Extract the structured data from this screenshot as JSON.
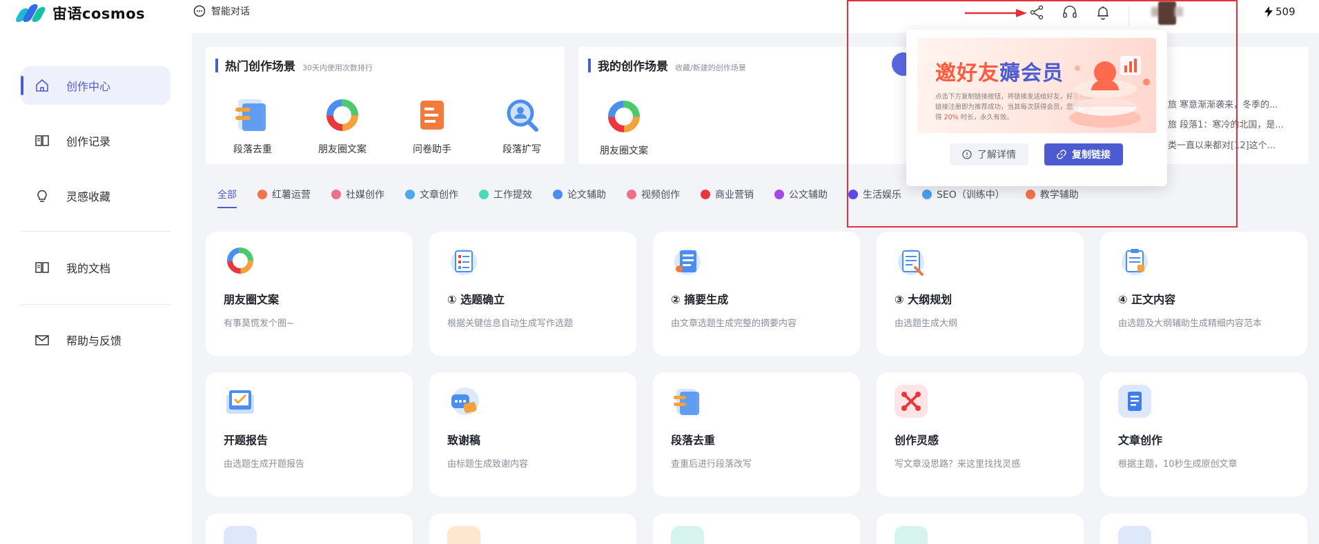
{
  "app": {
    "name": "宙语cosmos"
  },
  "topbar": {
    "smart_chat": "智能对话",
    "points": "509"
  },
  "sidebar": {
    "items": [
      {
        "label": "创作中心"
      },
      {
        "label": "创作记录"
      },
      {
        "label": "灵感收藏"
      },
      {
        "label": "我的文档"
      },
      {
        "label": "帮助与反馈"
      }
    ]
  },
  "hot": {
    "title": "热门创作场景",
    "subtitle": "30天内使用次数排行",
    "items": [
      "段落去重",
      "朋友圈文案",
      "问卷助手",
      "段落扩写"
    ]
  },
  "mine": {
    "title": "我的创作场景",
    "subtitle": "收藏/新建的创作场景",
    "items": [
      "朋友圈文案"
    ]
  },
  "recent": {
    "lines": [
      "旅 寒意渐渐袭来，冬季的...",
      "旅 段落1：寒冷的北国，是...",
      "类一直以来都对[12]这个..."
    ]
  },
  "categories": [
    {
      "label": "全部",
      "active": true
    },
    {
      "label": "红薯运营",
      "color": "#f2744a"
    },
    {
      "label": "社媒创作",
      "color": "#f0708c"
    },
    {
      "label": "文章创作",
      "color": "#4ba8f0"
    },
    {
      "label": "工作提效",
      "color": "#4cd9b8"
    },
    {
      "label": "论文辅助",
      "color": "#4a8ef0"
    },
    {
      "label": "视频创作",
      "color": "#f0708c"
    },
    {
      "label": "商业营销",
      "color": "#e8383d"
    },
    {
      "label": "公文辅助",
      "color": "#a04ae8"
    },
    {
      "label": "生活娱乐",
      "color": "#5b4ae8"
    },
    {
      "label": "SEO（训练中）",
      "color": "#4a9ef0"
    },
    {
      "label": "教学辅助",
      "color": "#f2744a"
    }
  ],
  "cards": [
    {
      "title": "朋友圈文案",
      "desc": "有事莫慌发个圈~",
      "icon": "colorful-ring-icon"
    },
    {
      "title": "① 选题确立",
      "desc": "根据关键信息自动生成写作选题",
      "icon": "checklist-icon"
    },
    {
      "title": "② 摘要生成",
      "desc": "由文章选题生成完整的摘要内容",
      "icon": "document-icon"
    },
    {
      "title": "③ 大纲规划",
      "desc": "由选题生成大纲",
      "icon": "outline-icon"
    },
    {
      "title": "④ 正文内容",
      "desc": "由选题及大纲辅助生成精细内容范本",
      "icon": "clipboard-icon"
    },
    {
      "title": "开题报告",
      "desc": "由选题生成开题报告",
      "icon": "report-icon"
    },
    {
      "title": "致谢稿",
      "desc": "由标题生成致谢内容",
      "icon": "chat-bubble-icon"
    },
    {
      "title": "段落去重",
      "desc": "查重后进行段落改写",
      "icon": "dedupe-icon"
    },
    {
      "title": "创作灵感",
      "desc": "写文章没思路？来这里找找灵感",
      "icon": "inspiration-icon"
    },
    {
      "title": "文章创作",
      "desc": "根据主题，10秒生成原创文章",
      "icon": "article-icon"
    }
  ],
  "popup": {
    "title_part1": "邀好友",
    "title_part2": "薅会员",
    "desc_before": "点击下方复制链接按钮，将链接发送给好友，好友点击链接注册即为推荐成功，当其每次获得会员，您均可获得",
    "desc_highlight": "20%",
    "desc_after": "时长，永久有效。",
    "detail_button": "了解详情",
    "copy_button": "复制链接"
  },
  "colors": {
    "accent": "#4d5bd1",
    "annotation": "#e5303b"
  }
}
